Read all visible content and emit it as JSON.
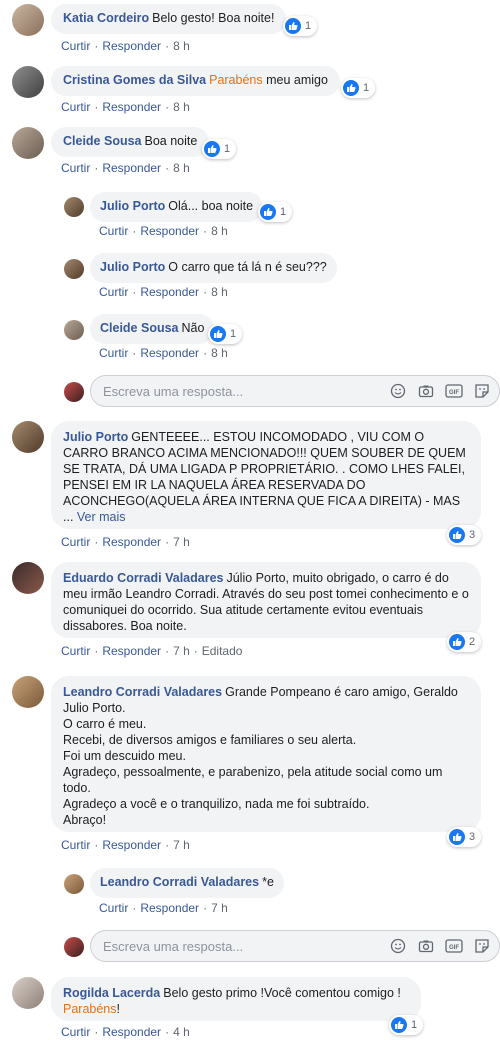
{
  "actions": {
    "like": "Curtir",
    "reply": "Responder",
    "sep": "·"
  },
  "comments": [
    {
      "author": "Katia Cordeiro",
      "text": "Belo gesto! Boa noite!",
      "time": "8 h",
      "reactions": "1"
    },
    {
      "author": "Cristina Gomes da Silva",
      "highlight": "Parabéns",
      "text": " meu amigo",
      "time": "8 h",
      "reactions": "1"
    },
    {
      "author": "Cleide Sousa",
      "text": "Boa noite",
      "time": "8 h",
      "reactions": "1",
      "replies": [
        {
          "author": "Julio Porto",
          "text": "Olá... boa noite",
          "time": "8 h",
          "reactions": "1"
        },
        {
          "author": "Julio Porto",
          "text": "O carro que tá lá n é seu???",
          "time": "8 h"
        },
        {
          "author": "Cleide Sousa",
          "text": "Não",
          "time": "8 h",
          "reactions": "1"
        }
      ]
    },
    {
      "author": "Julio Porto",
      "text": "GENTEEEE... ESTOU INCOMODADO , VIU COM O CARRO BRANCO ACIMA MENCIONADO!!! QUEM SOUBER DE QUEM SE TRATA, DÁ UMA LIGADA P PROPRIETÁRIO. . COMO LHES FALEI, PENSEI EM IR LA NAQUELA ÁREA RESERVADA DO ACONCHEGO(AQUELA ÁREA INTERNA QUE FICA A DIREITA) - MAS ...",
      "more": "Ver mais",
      "time": "7 h",
      "reactions": "3"
    },
    {
      "author": "Eduardo Corradi Valadares",
      "text": "Júlio Porto, muito obrigado, o carro é do meu irmão Leandro Corradi. Através do seu post tomei conhecimento e o comuniquei do ocorrido. Sua atitude certamente evitou eventuais dissabores. Boa noite.",
      "time": "7 h",
      "edited": "Editado",
      "reactions": "2"
    },
    {
      "author": "Leandro Corradi Valadares",
      "text": "Grande Pompeano é caro amigo, Geraldo Julio Porto.",
      "lines": [
        "O carro é meu.",
        "Recebi, de diversos amigos e familiares o seu alerta.",
        "Foi um descuido meu.",
        "Agradeço, pessoalmente, e parabenizo, pela atitude social como um todo.",
        "Agradeço a você e o tranquilizo, nada me foi subtraído.",
        "Abraço!"
      ],
      "time": "7 h",
      "reactions": "3",
      "replies": [
        {
          "author": "Leandro Corradi Valadares",
          "text": "*e",
          "time": "7 h"
        }
      ]
    },
    {
      "author": "Rogilda Lacerda",
      "text": "Belo gesto primo !Você comentou comigo ! ",
      "highlight": "Parabéns",
      "tail": "!",
      "time": "4 h",
      "reactions": "1"
    }
  ],
  "reply_input": {
    "placeholder": "Escreva uma resposta..."
  },
  "reply_icons": [
    "emoji-icon",
    "camera-icon",
    "gif-icon",
    "sticker-icon"
  ],
  "colors": {
    "link": "#385898",
    "highlight": "#e9710f",
    "like": "#1877f2",
    "bubble": "#f2f3f5"
  }
}
